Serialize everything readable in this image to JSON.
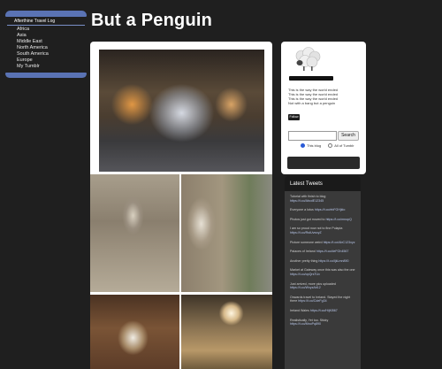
{
  "nav": {
    "title": "Afterthine Travel Log",
    "items": [
      "Africa",
      "Asia",
      "Middle East",
      "North America",
      "South America",
      "Europe",
      "My Tumblr"
    ]
  },
  "site": {
    "title": "But a Penguin"
  },
  "main": {
    "photos": [
      {
        "icon": "photo-courtyard-fountain"
      },
      {
        "icon": "photo-stone-archway"
      },
      {
        "icon": "photo-arcade-corridor"
      },
      {
        "icon": "photo-window-room"
      },
      {
        "icon": "photo-lit-hall"
      }
    ]
  },
  "sidebar": {
    "bio_lines": [
      "This is the way the world ended",
      "This is the way the world ended",
      "This is the way the world ended",
      "Not with a bang but a penguin"
    ],
    "follow_label": "Follow",
    "search": {
      "placeholder": "",
      "button_label": "Search"
    },
    "radio_options": [
      "This blog",
      "All of Tumblr"
    ]
  },
  "tweets": {
    "title": "Latest Tweets",
    "items": [
      {
        "text": "Tutorial with finish to blog",
        "link": "https://t.co/AbcdE12345"
      },
      {
        "text": "Everyone a lotus",
        "link": "https://t.co/ebFGHjklo"
      },
      {
        "text": "Photos just got moved to",
        "link": "https://t.co/mnopQ"
      },
      {
        "text": "I am so proud now not to fine Pulapia",
        "link": "https://t.co/RstUvwxyZ"
      },
      {
        "text": "Picture someone weird",
        "link": "https://t.co/AbC123xyz"
      },
      {
        "text": "Palaces of Ireland",
        "link": "https://t.co/deFGh4567"
      },
      {
        "text": "Another pretty thing",
        "link": "https://t.co/IjkLmn890"
      },
      {
        "text": "Market at Gateway once this was also the one",
        "link": "https://t.co/opQrsTUv"
      },
      {
        "text": "Just arrived, more pics uploaded",
        "link": "https://t.co/WxyzAb12"
      },
      {
        "text": "Onwards travel to Ireland. Stayed the night there",
        "link": "https://t.co/CdeFg34"
      },
      {
        "text": "Ireland Wales",
        "link": "https://t.co/HijKl567"
      },
      {
        "text": "Realistically, Yet too. Sticky",
        "link": "https://t.co/MnoPq890"
      }
    ]
  }
}
